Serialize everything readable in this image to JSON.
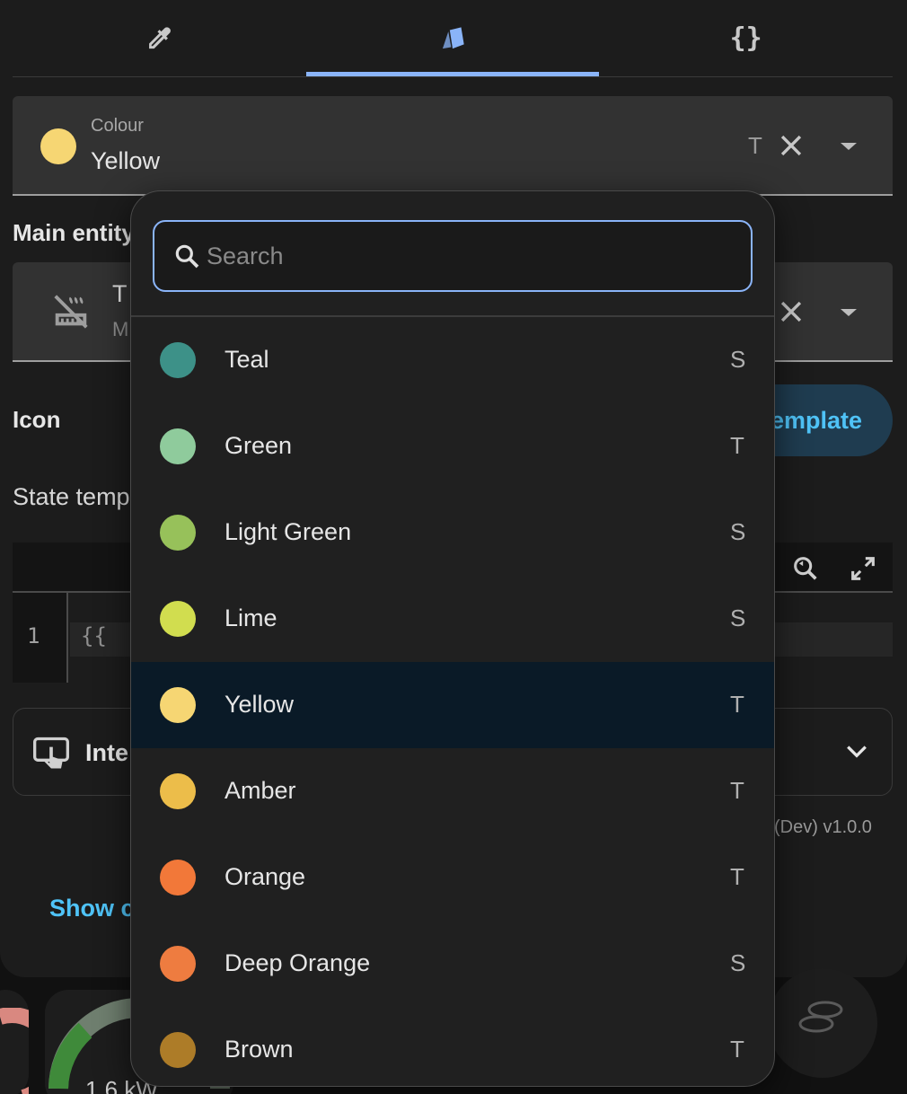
{
  "tabs": [
    {
      "icon": "eyedropper-icon"
    },
    {
      "icon": "palette-swatch-icon",
      "active": true
    },
    {
      "icon": "code-braces-icon",
      "text": "{}"
    }
  ],
  "colour_field": {
    "label": "Colour",
    "value": "Yellow",
    "type_badge": "T",
    "dot_color": "#f6d673"
  },
  "main_entity": {
    "heading": "Main entity",
    "name_initial": "T",
    "sub_initial": "M"
  },
  "icon_section": {
    "heading": "Icon",
    "template_button": "emplate"
  },
  "state_template": {
    "heading": "State temp",
    "line_number": "1",
    "code": "{{"
  },
  "interactions": {
    "label": "Inte"
  },
  "version": "(Dev) v1.0.0",
  "show_link": "Show c",
  "background": {
    "gauge_value": "1.6 kW"
  },
  "dropdown": {
    "search_placeholder": "Search",
    "options": [
      {
        "label": "Teal",
        "type": "S",
        "color": "#3d9188"
      },
      {
        "label": "Green",
        "type": "T",
        "color": "#8fcb9c"
      },
      {
        "label": "Light Green",
        "type": "S",
        "color": "#97c15a"
      },
      {
        "label": "Lime",
        "type": "S",
        "color": "#d1dd4f"
      },
      {
        "label": "Yellow",
        "type": "T",
        "color": "#f6d673",
        "selected": true
      },
      {
        "label": "Amber",
        "type": "T",
        "color": "#ecbd4a"
      },
      {
        "label": "Orange",
        "type": "T",
        "color": "#f27839"
      },
      {
        "label": "Deep Orange",
        "type": "S",
        "color": "#ee7c40"
      },
      {
        "label": "Brown",
        "type": "T",
        "color": "#ad7c28"
      }
    ]
  }
}
